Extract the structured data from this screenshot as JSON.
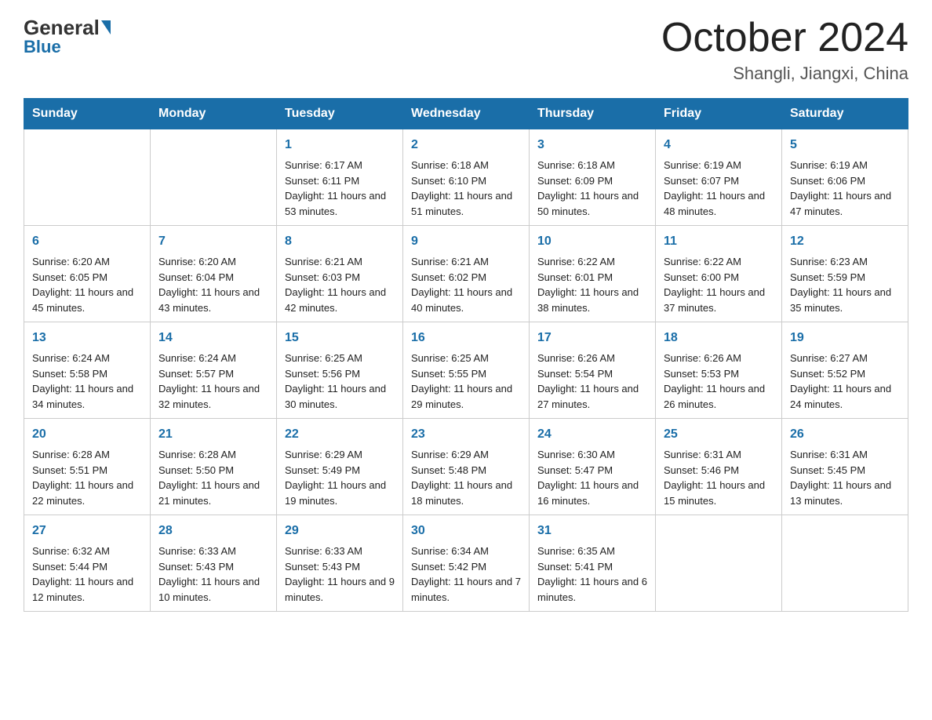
{
  "logo": {
    "general": "General",
    "blue": "Blue"
  },
  "title": "October 2024",
  "subtitle": "Shangli, Jiangxi, China",
  "days_of_week": [
    "Sunday",
    "Monday",
    "Tuesday",
    "Wednesday",
    "Thursday",
    "Friday",
    "Saturday"
  ],
  "weeks": [
    [
      {
        "day": "",
        "sunrise": "",
        "sunset": "",
        "daylight": ""
      },
      {
        "day": "",
        "sunrise": "",
        "sunset": "",
        "daylight": ""
      },
      {
        "day": "1",
        "sunrise": "Sunrise: 6:17 AM",
        "sunset": "Sunset: 6:11 PM",
        "daylight": "Daylight: 11 hours and 53 minutes."
      },
      {
        "day": "2",
        "sunrise": "Sunrise: 6:18 AM",
        "sunset": "Sunset: 6:10 PM",
        "daylight": "Daylight: 11 hours and 51 minutes."
      },
      {
        "day": "3",
        "sunrise": "Sunrise: 6:18 AM",
        "sunset": "Sunset: 6:09 PM",
        "daylight": "Daylight: 11 hours and 50 minutes."
      },
      {
        "day": "4",
        "sunrise": "Sunrise: 6:19 AM",
        "sunset": "Sunset: 6:07 PM",
        "daylight": "Daylight: 11 hours and 48 minutes."
      },
      {
        "day": "5",
        "sunrise": "Sunrise: 6:19 AM",
        "sunset": "Sunset: 6:06 PM",
        "daylight": "Daylight: 11 hours and 47 minutes."
      }
    ],
    [
      {
        "day": "6",
        "sunrise": "Sunrise: 6:20 AM",
        "sunset": "Sunset: 6:05 PM",
        "daylight": "Daylight: 11 hours and 45 minutes."
      },
      {
        "day": "7",
        "sunrise": "Sunrise: 6:20 AM",
        "sunset": "Sunset: 6:04 PM",
        "daylight": "Daylight: 11 hours and 43 minutes."
      },
      {
        "day": "8",
        "sunrise": "Sunrise: 6:21 AM",
        "sunset": "Sunset: 6:03 PM",
        "daylight": "Daylight: 11 hours and 42 minutes."
      },
      {
        "day": "9",
        "sunrise": "Sunrise: 6:21 AM",
        "sunset": "Sunset: 6:02 PM",
        "daylight": "Daylight: 11 hours and 40 minutes."
      },
      {
        "day": "10",
        "sunrise": "Sunrise: 6:22 AM",
        "sunset": "Sunset: 6:01 PM",
        "daylight": "Daylight: 11 hours and 38 minutes."
      },
      {
        "day": "11",
        "sunrise": "Sunrise: 6:22 AM",
        "sunset": "Sunset: 6:00 PM",
        "daylight": "Daylight: 11 hours and 37 minutes."
      },
      {
        "day": "12",
        "sunrise": "Sunrise: 6:23 AM",
        "sunset": "Sunset: 5:59 PM",
        "daylight": "Daylight: 11 hours and 35 minutes."
      }
    ],
    [
      {
        "day": "13",
        "sunrise": "Sunrise: 6:24 AM",
        "sunset": "Sunset: 5:58 PM",
        "daylight": "Daylight: 11 hours and 34 minutes."
      },
      {
        "day": "14",
        "sunrise": "Sunrise: 6:24 AM",
        "sunset": "Sunset: 5:57 PM",
        "daylight": "Daylight: 11 hours and 32 minutes."
      },
      {
        "day": "15",
        "sunrise": "Sunrise: 6:25 AM",
        "sunset": "Sunset: 5:56 PM",
        "daylight": "Daylight: 11 hours and 30 minutes."
      },
      {
        "day": "16",
        "sunrise": "Sunrise: 6:25 AM",
        "sunset": "Sunset: 5:55 PM",
        "daylight": "Daylight: 11 hours and 29 minutes."
      },
      {
        "day": "17",
        "sunrise": "Sunrise: 6:26 AM",
        "sunset": "Sunset: 5:54 PM",
        "daylight": "Daylight: 11 hours and 27 minutes."
      },
      {
        "day": "18",
        "sunrise": "Sunrise: 6:26 AM",
        "sunset": "Sunset: 5:53 PM",
        "daylight": "Daylight: 11 hours and 26 minutes."
      },
      {
        "day": "19",
        "sunrise": "Sunrise: 6:27 AM",
        "sunset": "Sunset: 5:52 PM",
        "daylight": "Daylight: 11 hours and 24 minutes."
      }
    ],
    [
      {
        "day": "20",
        "sunrise": "Sunrise: 6:28 AM",
        "sunset": "Sunset: 5:51 PM",
        "daylight": "Daylight: 11 hours and 22 minutes."
      },
      {
        "day": "21",
        "sunrise": "Sunrise: 6:28 AM",
        "sunset": "Sunset: 5:50 PM",
        "daylight": "Daylight: 11 hours and 21 minutes."
      },
      {
        "day": "22",
        "sunrise": "Sunrise: 6:29 AM",
        "sunset": "Sunset: 5:49 PM",
        "daylight": "Daylight: 11 hours and 19 minutes."
      },
      {
        "day": "23",
        "sunrise": "Sunrise: 6:29 AM",
        "sunset": "Sunset: 5:48 PM",
        "daylight": "Daylight: 11 hours and 18 minutes."
      },
      {
        "day": "24",
        "sunrise": "Sunrise: 6:30 AM",
        "sunset": "Sunset: 5:47 PM",
        "daylight": "Daylight: 11 hours and 16 minutes."
      },
      {
        "day": "25",
        "sunrise": "Sunrise: 6:31 AM",
        "sunset": "Sunset: 5:46 PM",
        "daylight": "Daylight: 11 hours and 15 minutes."
      },
      {
        "day": "26",
        "sunrise": "Sunrise: 6:31 AM",
        "sunset": "Sunset: 5:45 PM",
        "daylight": "Daylight: 11 hours and 13 minutes."
      }
    ],
    [
      {
        "day": "27",
        "sunrise": "Sunrise: 6:32 AM",
        "sunset": "Sunset: 5:44 PM",
        "daylight": "Daylight: 11 hours and 12 minutes."
      },
      {
        "day": "28",
        "sunrise": "Sunrise: 6:33 AM",
        "sunset": "Sunset: 5:43 PM",
        "daylight": "Daylight: 11 hours and 10 minutes."
      },
      {
        "day": "29",
        "sunrise": "Sunrise: 6:33 AM",
        "sunset": "Sunset: 5:43 PM",
        "daylight": "Daylight: 11 hours and 9 minutes."
      },
      {
        "day": "30",
        "sunrise": "Sunrise: 6:34 AM",
        "sunset": "Sunset: 5:42 PM",
        "daylight": "Daylight: 11 hours and 7 minutes."
      },
      {
        "day": "31",
        "sunrise": "Sunrise: 6:35 AM",
        "sunset": "Sunset: 5:41 PM",
        "daylight": "Daylight: 11 hours and 6 minutes."
      },
      {
        "day": "",
        "sunrise": "",
        "sunset": "",
        "daylight": ""
      },
      {
        "day": "",
        "sunrise": "",
        "sunset": "",
        "daylight": ""
      }
    ]
  ]
}
